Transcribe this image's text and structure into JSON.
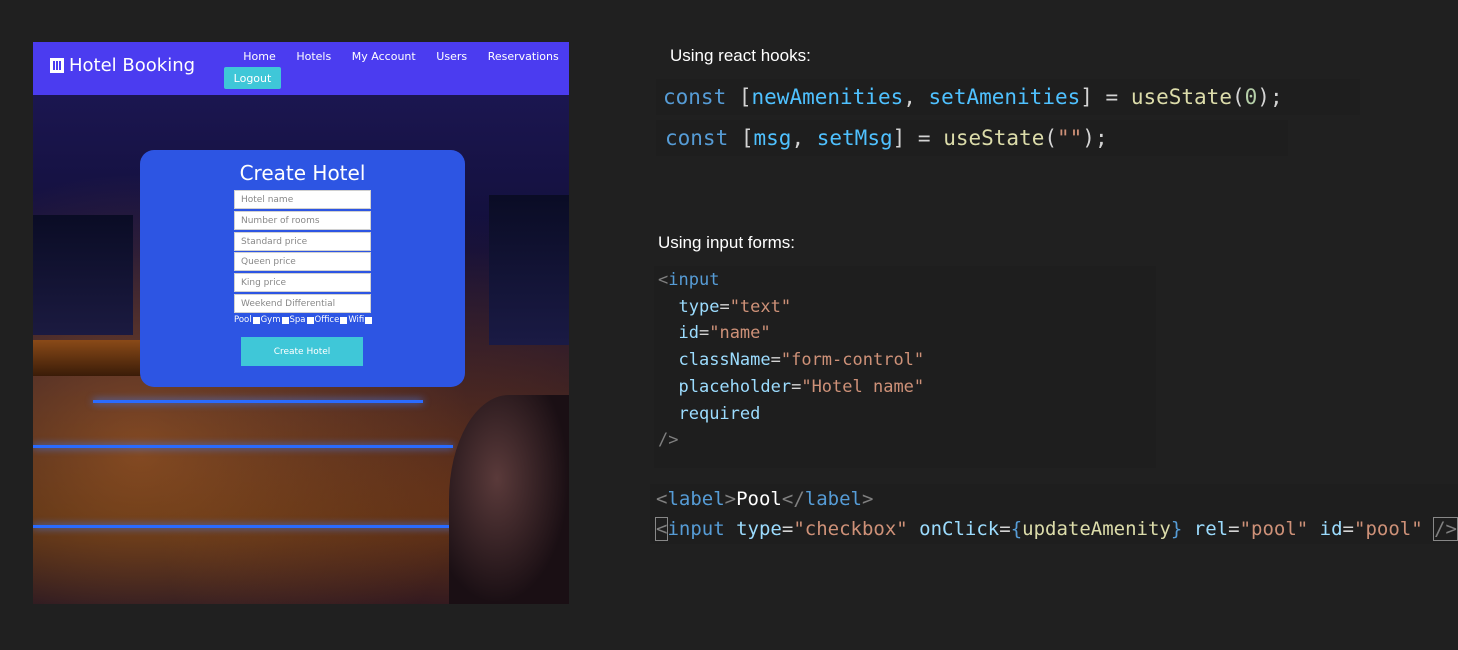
{
  "app": {
    "brand": "Hotel Booking",
    "nav": [
      "Home",
      "Hotels",
      "My Account",
      "Users",
      "Reservations"
    ],
    "logout": "Logout"
  },
  "form": {
    "title": "Create Hotel",
    "placeholders": [
      "Hotel name",
      "Number of rooms",
      "Standard price",
      "Queen price",
      "King price",
      "Weekend Differential"
    ],
    "amenities": [
      "Pool",
      "Gym",
      "Spa",
      "Office",
      "Wifi"
    ],
    "submit": "Create Hotel"
  },
  "sections": {
    "hooks_heading": "Using react hooks:",
    "forms_heading": "Using input forms:"
  },
  "code": {
    "hook1": {
      "kw": "const",
      "open": " [",
      "a": "newAmenities",
      "sep": ", ",
      "b": "setAmenities",
      "eq": "] = ",
      "fn": "useState",
      "lp": "(",
      "arg": "0",
      "rp": ");"
    },
    "hook2": {
      "kw": "const",
      "open": " [",
      "a": "msg",
      "sep": ", ",
      "b": "setMsg",
      "eq": "] = ",
      "fn": "useState",
      "lp": "(",
      "arg": "\"\"",
      "rp": ");"
    },
    "input": {
      "open": "<",
      "tag": "input",
      "attrs": [
        {
          "name": "type",
          "value": "\"text\""
        },
        {
          "name": "id",
          "value": "\"name\""
        },
        {
          "name": "className",
          "value": "\"form-control\""
        },
        {
          "name": "placeholder",
          "value": "\"Hotel name\""
        }
      ],
      "required": "required",
      "close": "/>"
    },
    "label_line": {
      "lt": "<",
      "tag": "label",
      "gt": ">",
      "text": "Pool",
      "close_lt": "</",
      "close_tag": "label",
      "close_gt": ">"
    },
    "checkbox_line": {
      "lt": "<",
      "tag": "input",
      "type_attr": "type",
      "type_val": "\"checkbox\"",
      "onclick_attr": "onClick",
      "brace_open": "{",
      "handler": "updateAmenity",
      "brace_close": "}",
      "rel_attr": "rel",
      "rel_val": "\"pool\"",
      "id_attr": "id",
      "id_val": "\"pool\"",
      "end": "/>"
    }
  }
}
